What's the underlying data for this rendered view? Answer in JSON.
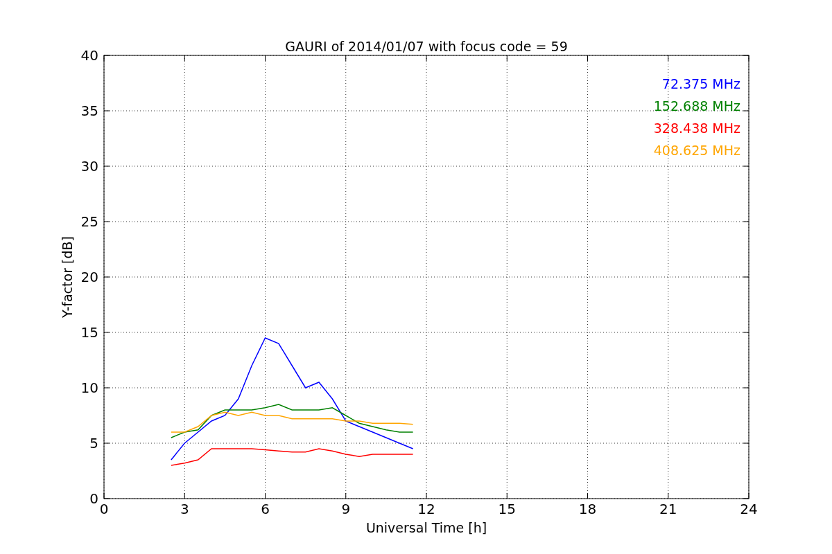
{
  "figure": {
    "chart_data": {
      "type": "line",
      "title": "GAURI of 2014/01/07 with focus code = 59",
      "xlabel": "Universal Time [h]",
      "ylabel": "Y-factor [dB]",
      "x": [
        2.5,
        3,
        3.5,
        4,
        4.5,
        5,
        5.5,
        6,
        6.5,
        7,
        7.5,
        8,
        8.5,
        9,
        9.5,
        10,
        10.5,
        11,
        11.5
      ],
      "series": [
        {
          "name": "72.375 MHz",
          "color": "#0000ff",
          "values": [
            3.5,
            5,
            6,
            7,
            7.5,
            9,
            12,
            14.5,
            14,
            12,
            10,
            10.5,
            9,
            7,
            6.5,
            6,
            5.5,
            5,
            4.5
          ]
        },
        {
          "name": "152.688 MHz",
          "color": "#008000",
          "values": [
            5.5,
            6,
            6.2,
            7.5,
            8,
            8,
            8,
            8.2,
            8.5,
            8,
            8,
            8,
            8.2,
            7.5,
            6.8,
            6.5,
            6.2,
            6,
            6
          ]
        },
        {
          "name": "328.438 MHz",
          "color": "#ff0000",
          "values": [
            3,
            3.2,
            3.5,
            4.5,
            4.5,
            4.5,
            4.5,
            4.4,
            4.3,
            4.2,
            4.2,
            4.5,
            4.3,
            4,
            3.8,
            4,
            4,
            4,
            4
          ]
        },
        {
          "name": "408.625 MHz",
          "color": "#ffa500",
          "values": [
            6,
            6,
            6.5,
            7.5,
            7.8,
            7.5,
            7.8,
            7.5,
            7.5,
            7.2,
            7.2,
            7.2,
            7.2,
            7,
            7,
            6.8,
            6.8,
            6.8,
            6.7
          ]
        }
      ],
      "xlim": [
        0,
        24
      ],
      "ylim": [
        0,
        40
      ],
      "xticks": [
        0,
        3,
        6,
        9,
        12,
        15,
        18,
        21,
        24
      ],
      "yticks": [
        0,
        5,
        10,
        15,
        20,
        25,
        30,
        35,
        40
      ],
      "grid": true
    }
  }
}
